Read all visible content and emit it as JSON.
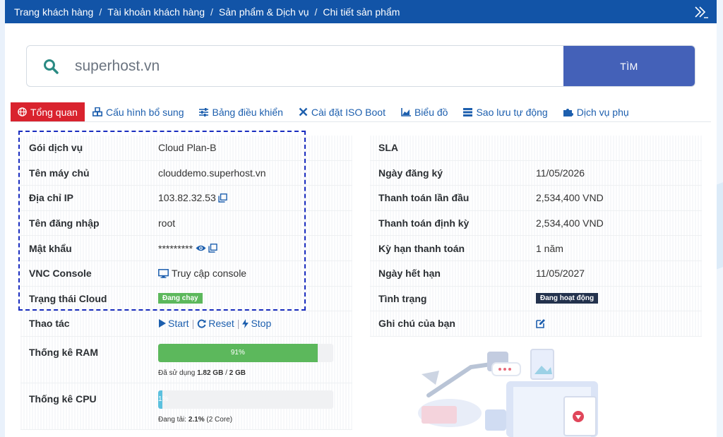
{
  "breadcrumb": [
    "Trang khách hàng",
    "Tài khoản khách hàng",
    "Sản phẩm & Dịch vụ",
    "Chi tiết sản phẩm"
  ],
  "search": {
    "value": "superhost.vn",
    "button": "TÌM"
  },
  "tabs": [
    {
      "label": "Tổng quan",
      "icon": "globe-icon",
      "active": true
    },
    {
      "label": "Cấu hình bổ sung",
      "icon": "cubes-icon"
    },
    {
      "label": "Bảng điều khiển",
      "icon": "sliders-icon"
    },
    {
      "label": "Cài đặt ISO Boot",
      "icon": "tools-icon"
    },
    {
      "label": "Biểu đồ",
      "icon": "area-chart-icon"
    },
    {
      "label": "Sao lưu tự động",
      "icon": "server-icon"
    },
    {
      "label": "Dịch vụ phụ",
      "icon": "puzzle-icon"
    }
  ],
  "left": {
    "plan_label": "Gói dịch vụ",
    "plan_value": "Cloud Plan-B",
    "hostname_label": "Tên máy chủ",
    "hostname_value": "clouddemo.superhost.vn",
    "ip_label": "Địa chỉ IP",
    "ip_value": "103.82.32.53",
    "user_label": "Tên đăng nhập",
    "user_value": "root",
    "pass_label": "Mật khẩu",
    "pass_value": "*********",
    "vnc_label": "VNC Console",
    "vnc_value": "Truy cập console",
    "status_label": "Trạng thái Cloud",
    "status_value": "Đang chạy",
    "actions_label": "Thao tác",
    "start": "Start",
    "reset": "Reset",
    "stop": "Stop",
    "ram_label": "Thống kê RAM",
    "ram_percent": 91,
    "ram_text": "91%",
    "ram_note_prefix": "Đã sử dụng ",
    "ram_used": "1.82 GB",
    "ram_sep": " / ",
    "ram_total": "2 GB",
    "cpu_label": "Thống kê CPU",
    "cpu_percent": 2.1,
    "cpu_text": "2.1%",
    "cpu_note_prefix": "Đang tải: ",
    "cpu_load": "2.1%",
    "cpu_cores": " (2 Core)"
  },
  "right": {
    "sla_label": "SLA",
    "reg_label": "Ngày đăng ký",
    "reg_value": "11/05/2026",
    "first_pay_label": "Thanh toán lần đầu",
    "first_pay_value": "2,534,400 VND",
    "recurring_label": "Thanh toán định kỳ",
    "recurring_value": "2,534,400 VND",
    "cycle_label": "Kỳ hạn thanh toán",
    "cycle_value": "1 năm",
    "expiry_label": "Ngày hết hạn",
    "expiry_value": "11/05/2027",
    "state_label": "Tình trạng",
    "state_value": "Đang hoạt động",
    "note_label": "Ghi chú của bạn"
  },
  "colors": {
    "header": "#1254a7",
    "active_tab": "#d9232e",
    "search_btn": "#4461b8",
    "link": "#1d5fae",
    "ram_bar": "#5cb85c",
    "cpu_bar": "#5bc0de"
  }
}
